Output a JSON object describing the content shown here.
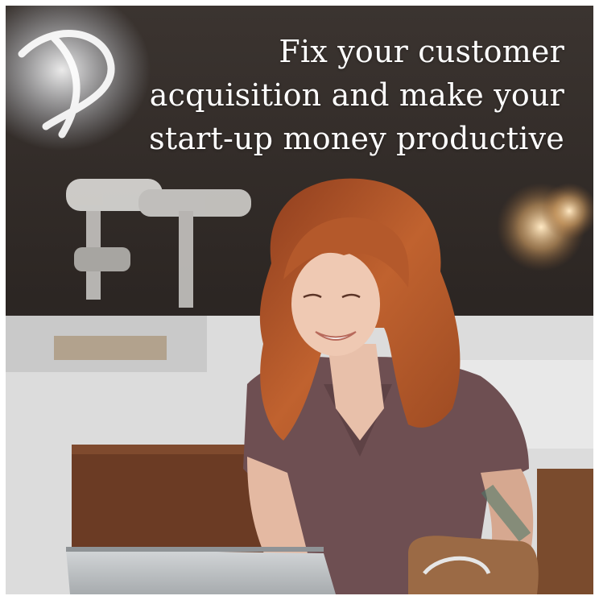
{
  "headline": {
    "line1": "Fix your customer",
    "line2": "acquisition and make your",
    "line3": "start-up money productive"
  },
  "photo": {
    "subject": "woman-with-laptop",
    "colors": {
      "hair": "#b5522a",
      "shirt": "#6e4f52",
      "background_dark": "#2b2522",
      "counter": "#e9e9e9",
      "chair": "#6b3b24",
      "laptop": "#bfc3c6"
    }
  }
}
